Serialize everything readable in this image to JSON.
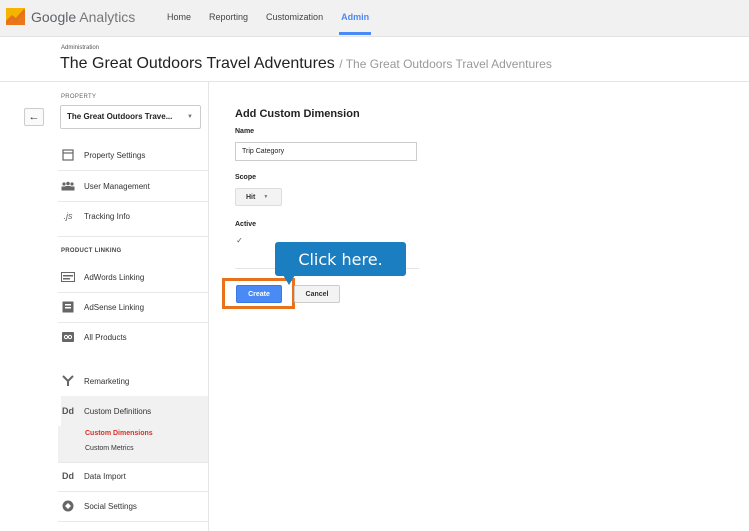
{
  "app": {
    "logo_brand": "Google",
    "logo_product": "Analytics"
  },
  "nav": {
    "items": [
      {
        "label": "Home"
      },
      {
        "label": "Reporting"
      },
      {
        "label": "Customization"
      },
      {
        "label": "Admin",
        "active": true
      }
    ]
  },
  "header": {
    "section": "Administration",
    "title": "The Great Outdoors Travel Adventures",
    "subtitle": "/ The Great Outdoors Travel Adventures"
  },
  "sidebar": {
    "back_icon": "←",
    "property_label": "PROPERTY",
    "property_value": "The Great Outdoors Trave...",
    "items": [
      {
        "label": "Property Settings",
        "icon": "property-settings-icon"
      },
      {
        "label": "User Management",
        "icon": "users-icon"
      },
      {
        "label": "Tracking Info",
        "icon": "js-icon"
      }
    ],
    "product_linking_label": "PRODUCT LINKING",
    "linking_items": [
      {
        "label": "AdWords Linking",
        "icon": "adwords-icon"
      },
      {
        "label": "AdSense Linking",
        "icon": "adsense-icon"
      },
      {
        "label": "All Products",
        "icon": "all-products-icon"
      }
    ],
    "remarketing": {
      "label": "Remarketing",
      "icon": "remarketing-icon"
    },
    "custom_definitions": {
      "label": "Custom Definitions",
      "icon_text": "Dd",
      "sub_items": [
        {
          "label": "Custom Dimensions",
          "active": true
        },
        {
          "label": "Custom Metrics"
        }
      ]
    },
    "data_import": {
      "label": "Data Import",
      "icon_text": "Dd"
    },
    "social_settings": {
      "label": "Social Settings",
      "icon": "social-icon"
    }
  },
  "form": {
    "title": "Add Custom Dimension",
    "name_label": "Name",
    "name_value": "Trip Category",
    "scope_label": "Scope",
    "scope_value": "Hit",
    "active_label": "Active",
    "active_checked": true,
    "create_label": "Create",
    "cancel_label": "Cancel"
  },
  "callout": {
    "text": "Click here.",
    "color": "#1a7ec0"
  },
  "colors": {
    "accent": "#4a8af4",
    "highlight": "#e8711c",
    "active_link": "#d93025"
  }
}
